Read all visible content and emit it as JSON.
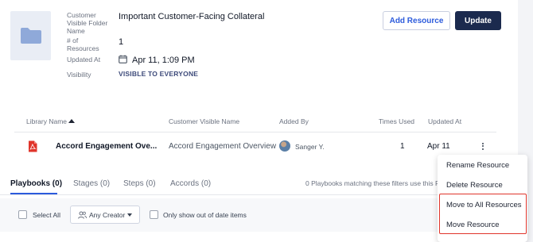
{
  "folder": {
    "labels": {
      "name": "Customer Visible Folder Name",
      "resources": "# of Resources",
      "updated": "Updated At",
      "visibility": "Visibility"
    },
    "name": "Important Customer-Facing Collateral",
    "resource_count": "1",
    "updated_at": "Apr 11, 1:09 PM",
    "visibility": "VISIBLE TO EVERYONE",
    "icons": {
      "thumbnail": "folder-icon",
      "updated": "calendar-icon"
    }
  },
  "actions": {
    "add_resource": "Add Resource",
    "update": "Update"
  },
  "table": {
    "headers": {
      "library_name": "Library Name",
      "customer_visible_name": "Customer Visible Name",
      "added_by": "Added By",
      "times_used": "Times Used",
      "updated_at": "Updated At"
    },
    "sort": {
      "column": "library_name",
      "direction": "ascending"
    },
    "rows": [
      {
        "file_type_icon": "pdf-icon",
        "library_name": "Accord Engagement Ove...",
        "customer_visible_name": "Accord Engagement Overview",
        "added_by": "Sanger Y.",
        "times_used": "1",
        "updated_at": "Apr 11"
      }
    ]
  },
  "context_menu": {
    "items": [
      "Rename Resource",
      "Delete Resource",
      "Move to All Resources",
      "Move Resource"
    ],
    "highlight_color": "#e0352b"
  },
  "tabs": {
    "items": [
      "Playbooks (0)",
      "Stages (0)",
      "Steps (0)",
      "Accords (0)"
    ],
    "active_index": 0,
    "info": "0 Playbooks matching these filters use this Resource"
  },
  "filters": {
    "select_all": "Select All",
    "creator": "Any Creator",
    "out_of_date": "Only show out of date items"
  },
  "colors": {
    "accent": "#2c5bdc",
    "primary_button": "#1b2a4e",
    "pdf": "#e0352b"
  }
}
